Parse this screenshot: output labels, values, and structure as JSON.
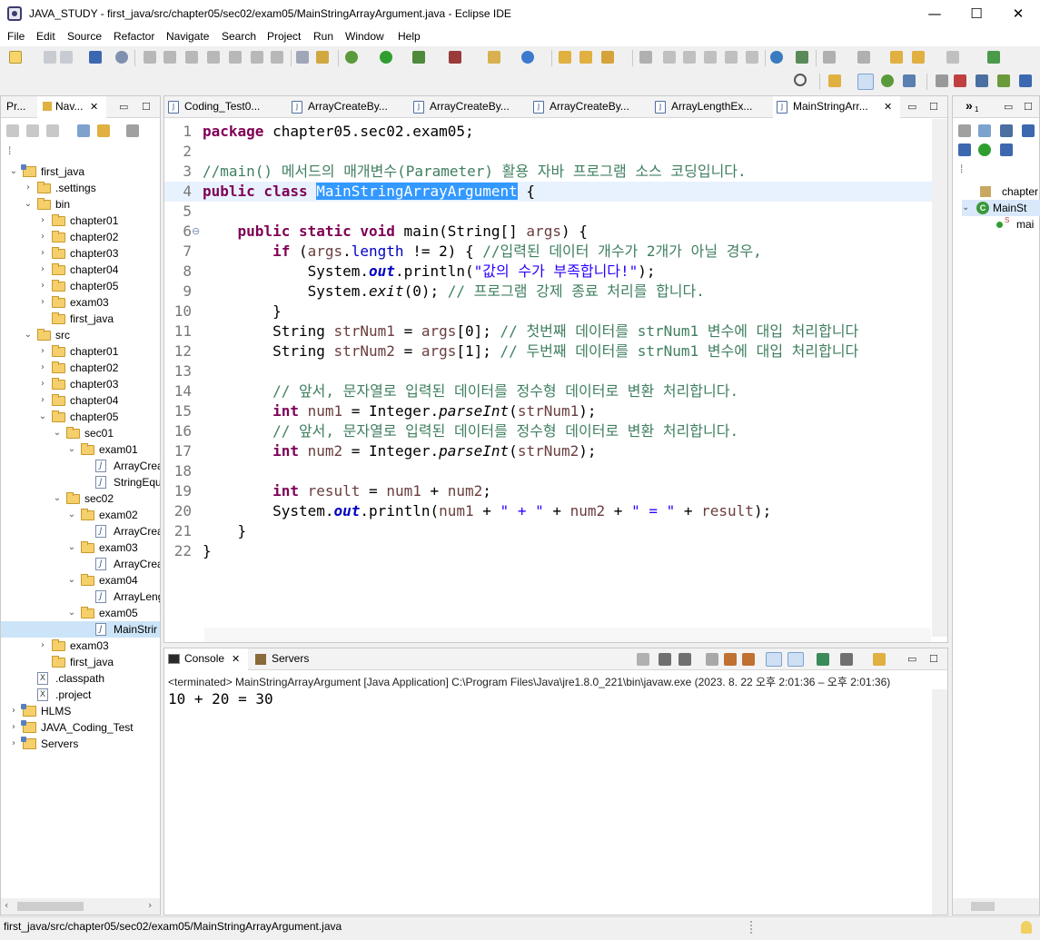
{
  "window": {
    "title": "JAVA_STUDY - first_java/src/chapter05/sec02/exam05/MainStringArrayArgument.java - Eclipse IDE",
    "minimize": "—",
    "maximize": "☐",
    "close": "✕"
  },
  "menu": [
    "File",
    "Edit",
    "Source",
    "Refactor",
    "Navigate",
    "Search",
    "Project",
    "Run",
    "Window",
    "Help"
  ],
  "left_panel": {
    "tabs": [
      {
        "label": "Pr..."
      },
      {
        "label": "Nav..."
      }
    ],
    "tree": [
      {
        "label": "first_java",
        "indent": 0,
        "kind": "project",
        "twisty": "open"
      },
      {
        "label": ".settings",
        "indent": 1,
        "kind": "folder",
        "twisty": "closed"
      },
      {
        "label": "bin",
        "indent": 1,
        "kind": "folder",
        "twisty": "open"
      },
      {
        "label": "chapter01",
        "indent": 2,
        "kind": "folder",
        "twisty": "closed"
      },
      {
        "label": "chapter02",
        "indent": 2,
        "kind": "folder",
        "twisty": "closed"
      },
      {
        "label": "chapter03",
        "indent": 2,
        "kind": "folder",
        "twisty": "closed"
      },
      {
        "label": "chapter04",
        "indent": 2,
        "kind": "folder",
        "twisty": "closed"
      },
      {
        "label": "chapter05",
        "indent": 2,
        "kind": "folder",
        "twisty": "closed"
      },
      {
        "label": "exam03",
        "indent": 2,
        "kind": "folder",
        "twisty": "closed"
      },
      {
        "label": "first_java",
        "indent": 2,
        "kind": "folder",
        "twisty": ""
      },
      {
        "label": "src",
        "indent": 1,
        "kind": "folder",
        "twisty": "open"
      },
      {
        "label": "chapter01",
        "indent": 2,
        "kind": "folder",
        "twisty": "closed"
      },
      {
        "label": "chapter02",
        "indent": 2,
        "kind": "folder",
        "twisty": "closed"
      },
      {
        "label": "chapter03",
        "indent": 2,
        "kind": "folder",
        "twisty": "closed"
      },
      {
        "label": "chapter04",
        "indent": 2,
        "kind": "folder",
        "twisty": "closed"
      },
      {
        "label": "chapter05",
        "indent": 2,
        "kind": "folder",
        "twisty": "open"
      },
      {
        "label": "sec01",
        "indent": 3,
        "kind": "folder",
        "twisty": "open"
      },
      {
        "label": "exam01",
        "indent": 4,
        "kind": "folder",
        "twisty": "open"
      },
      {
        "label": "ArrayCrea",
        "indent": 5,
        "kind": "java",
        "twisty": ""
      },
      {
        "label": "StringEqu",
        "indent": 5,
        "kind": "java",
        "twisty": ""
      },
      {
        "label": "sec02",
        "indent": 3,
        "kind": "folder",
        "twisty": "open"
      },
      {
        "label": "exam02",
        "indent": 4,
        "kind": "folder",
        "twisty": "open"
      },
      {
        "label": "ArrayCrea",
        "indent": 5,
        "kind": "java",
        "twisty": ""
      },
      {
        "label": "exam03",
        "indent": 4,
        "kind": "folder",
        "twisty": "open"
      },
      {
        "label": "ArrayCrea",
        "indent": 5,
        "kind": "java",
        "twisty": ""
      },
      {
        "label": "exam04",
        "indent": 4,
        "kind": "folder",
        "twisty": "open"
      },
      {
        "label": "ArrayLeng",
        "indent": 5,
        "kind": "java",
        "twisty": ""
      },
      {
        "label": "exam05",
        "indent": 4,
        "kind": "folder",
        "twisty": "open"
      },
      {
        "label": "MainStrir",
        "indent": 5,
        "kind": "java",
        "twisty": "",
        "selected": true
      },
      {
        "label": "exam03",
        "indent": 2,
        "kind": "folder",
        "twisty": "closed"
      },
      {
        "label": "first_java",
        "indent": 2,
        "kind": "folder",
        "twisty": ""
      },
      {
        "label": ".classpath",
        "indent": 1,
        "kind": "xml",
        "twisty": ""
      },
      {
        "label": ".project",
        "indent": 1,
        "kind": "xml",
        "twisty": ""
      },
      {
        "label": "HLMS",
        "indent": 0,
        "kind": "project",
        "twisty": "closed"
      },
      {
        "label": "JAVA_Coding_Test",
        "indent": 0,
        "kind": "project",
        "twisty": "closed"
      },
      {
        "label": "Servers",
        "indent": 0,
        "kind": "project",
        "twisty": "closed"
      }
    ]
  },
  "editor": {
    "tabs": [
      {
        "label": "Coding_Test0..."
      },
      {
        "label": "ArrayCreateBy..."
      },
      {
        "label": "ArrayCreateBy..."
      },
      {
        "label": "ArrayCreateBy..."
      },
      {
        "label": "ArrayLengthEx..."
      },
      {
        "label": "MainStringArr...",
        "active": true
      }
    ],
    "close_glyph": "✕",
    "line_numbers": [
      "1",
      "2",
      "3",
      "4",
      "5",
      "6",
      "7",
      "8",
      "9",
      "10",
      "11",
      "12",
      "13",
      "14",
      "15",
      "16",
      "17",
      "18",
      "19",
      "20",
      "21",
      "22"
    ],
    "fold_marker": "⊖",
    "code": {
      "l1_kw": "package",
      "l1_rest": " chapter05.sec02.exam05;",
      "l3_comment": "//main() 메서드의 매개변수(Parameter) 활용 자바 프로그램 소스 코딩입니다.",
      "l4_kw": "public class",
      "l4_sp": " ",
      "l4_name": "MainStringArrayArgument",
      "l4_rest": " {",
      "l6_indent": "    ",
      "l6_kw": "public static void",
      "l6_rest": " main(String[] ",
      "l6_args": "args",
      "l6_end": ") {",
      "l7_indent": "        ",
      "l7_kw": "if",
      "l7_a": " (",
      "l7_args": "args",
      "l7_b": ".",
      "l7_field": "length",
      "l7_c": " != 2) { ",
      "l7_comment": "//입력된 데이터 개수가 2개가 아닐 경우,",
      "l8_indent": "            ",
      "l8_a": "System.",
      "l8_out": "out",
      "l8_b": ".println(",
      "l8_str": "\"값의 수가 부족합니다!\"",
      "l8_c": ");",
      "l9_indent": "            ",
      "l9_a": "System.",
      "l9_exit": "exit",
      "l9_b": "(0); ",
      "l9_comment": "// 프로그램 강제 종료 처리를 합니다.",
      "l10": "        }",
      "l11_a": "        String ",
      "l11_var": "strNum1",
      "l11_b": " = ",
      "l11_args": "args",
      "l11_c": "[0]; ",
      "l11_comment": "// 첫번째 데이터를 strNum1 변수에 대입 처리합니다",
      "l12_a": "        String ",
      "l12_var": "strNum2",
      "l12_b": " = ",
      "l12_args": "args",
      "l12_c": "[1]; ",
      "l12_comment": "// 두번째 데이터를 strNum1 변수에 대입 처리합니다",
      "l14_comment": "        // 앞서, 문자열로 입력된 데이터를 정수형 데이터로 변환 처리합니다.",
      "l15_indent": "        ",
      "l15_kw": "int",
      "l15_a": " ",
      "l15_var": "num1",
      "l15_b": " = Integer.",
      "l15_m": "parseInt",
      "l15_c": "(",
      "l15_arg": "strNum1",
      "l15_d": ");",
      "l16_comment": "        // 앞서, 문자열로 입력된 데이터를 정수형 데이터로 변환 처리합니다.",
      "l17_indent": "        ",
      "l17_kw": "int",
      "l17_a": " ",
      "l17_var": "num2",
      "l17_b": " = Integer.",
      "l17_m": "parseInt",
      "l17_c": "(",
      "l17_arg": "strNum2",
      "l17_d": ");",
      "l19_indent": "        ",
      "l19_kw": "int",
      "l19_a": " ",
      "l19_var": "result",
      "l19_b": " = ",
      "l19_v1": "num1",
      "l19_c": " + ",
      "l19_v2": "num2",
      "l19_d": ";",
      "l20_indent": "        ",
      "l20_a": "System.",
      "l20_out": "out",
      "l20_b": ".println(",
      "l20_v1": "num1",
      "l20_c": " + ",
      "l20_s1": "\" + \"",
      "l20_d": " + ",
      "l20_v2": "num2",
      "l20_e": " + ",
      "l20_s2": "\" = \"",
      "l20_f": " + ",
      "l20_v3": "result",
      "l20_g": ");",
      "l21": "    }",
      "l22": "}"
    }
  },
  "outline": {
    "chevron": "»",
    "chevron_sub": "1",
    "items": [
      {
        "label": "chapter"
      },
      {
        "label": "MainSt"
      },
      {
        "label": "mai"
      }
    ]
  },
  "console": {
    "tabs": [
      {
        "label": "Console",
        "active": true
      },
      {
        "label": "Servers"
      }
    ],
    "status": "<terminated> MainStringArrayArgument [Java Application] C:\\Program Files\\Java\\jre1.8.0_221\\bin\\javaw.exe  (2023. 8. 22 오후 2:01:36 – 오후 2:01:36)",
    "output": "10 + 20 = 30"
  },
  "statusbar": {
    "path": "first_java/src/chapter05/sec02/exam05/MainStringArrayArgument.java"
  },
  "colors": {
    "keyword": "#7f0055",
    "comment": "#3f7f5f",
    "string": "#2a00ff",
    "field": "#0000c0",
    "selection": "#3399ff"
  }
}
